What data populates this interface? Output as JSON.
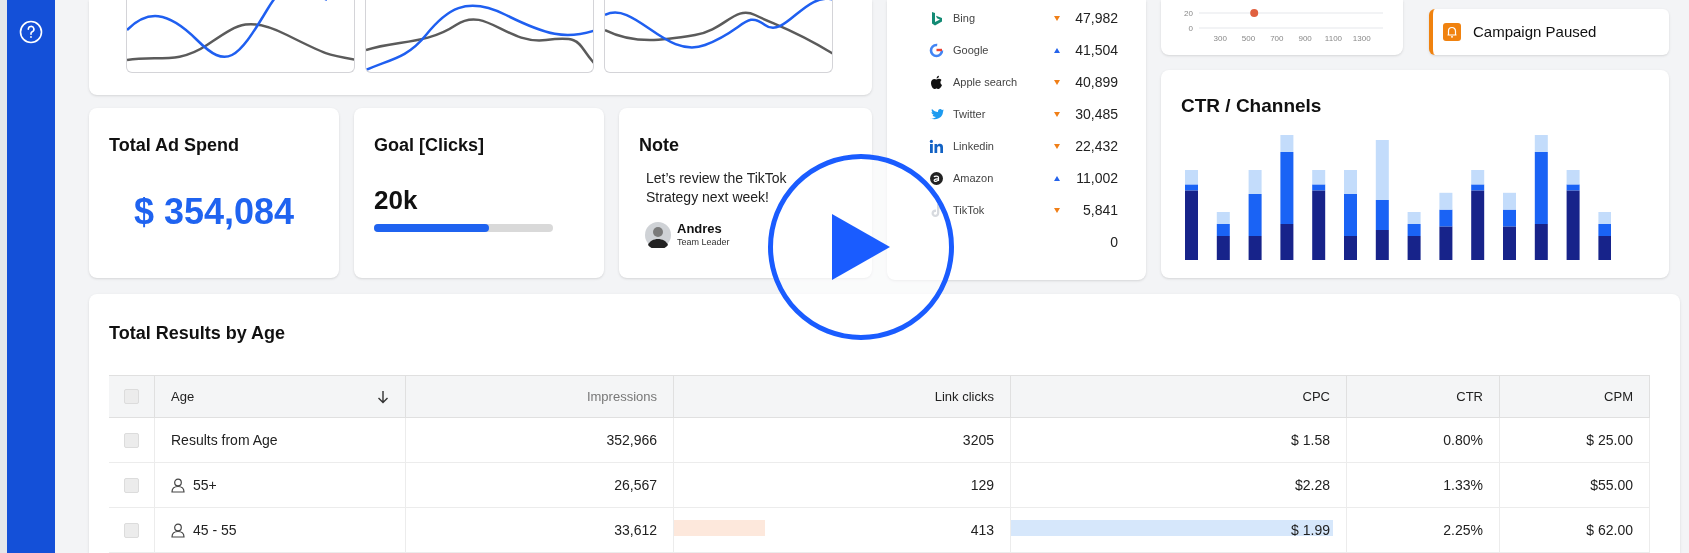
{
  "ad_spend": {
    "title": "Total Ad Spend",
    "value": "$ 354,084"
  },
  "goal": {
    "title": "Goal [Clicks]",
    "value": "20k",
    "level": 0.64
  },
  "note": {
    "title": "Note",
    "text": "Let’s review the TikTok Strategy next week!",
    "author": "Andres",
    "role": "Team Leader"
  },
  "channels": [
    {
      "name": "Bing",
      "up": false,
      "value": "47,982"
    },
    {
      "name": "Google",
      "up": true,
      "value": "41,504"
    },
    {
      "name": "Apple search",
      "up": false,
      "value": "40,899"
    },
    {
      "name": "Twitter",
      "up": false,
      "value": "30,485"
    },
    {
      "name": "Linkedin",
      "up": false,
      "value": "22,432"
    },
    {
      "name": "Amazon",
      "up": true,
      "value": "11,002"
    },
    {
      "name": "TikTok",
      "up": false,
      "value": "5,841"
    },
    {
      "value": "0"
    }
  ],
  "scatter": {
    "chart_data": {
      "type": "scatter",
      "x": [
        540
      ],
      "values": [
        20
      ],
      "xlim": [
        150,
        1450
      ],
      "ylim": [
        0,
        20
      ],
      "xticks": [
        300,
        500,
        700,
        900,
        1100,
        1300
      ],
      "yticks": [
        0,
        20
      ]
    }
  },
  "alert": {
    "text": "Campaign Paused"
  },
  "ctr_chart": {
    "title": "CTR / Channels"
  },
  "table": {
    "title": "Total Results by Age",
    "header_checked": false,
    "columns": [
      "Age",
      "Impressions",
      "Link clicks",
      "CPC",
      "CTR",
      "CPM"
    ],
    "rows": [
      {
        "kind": "total",
        "checked": false,
        "cells": [
          "Results from Age",
          "352,966",
          "3205",
          "$ 1.58",
          "0.80%",
          "$ 25.00"
        ]
      },
      {
        "kind": "age_group",
        "checked": false,
        "cells": [
          "55+",
          "26,567",
          "129",
          "$2.28",
          "1.33%",
          "$55.00"
        ]
      },
      {
        "kind": "age_group",
        "checked": false,
        "cells": [
          "45 - 55",
          "33,612",
          "413",
          "$ 1.99",
          "2.25%",
          "$ 62.00"
        ],
        "clicks_bar": {
          "level": 0.27
        },
        "cpc_bar": {
          "level": 0.96
        }
      }
    ]
  },
  "play_button": {
    "visible": true
  }
}
